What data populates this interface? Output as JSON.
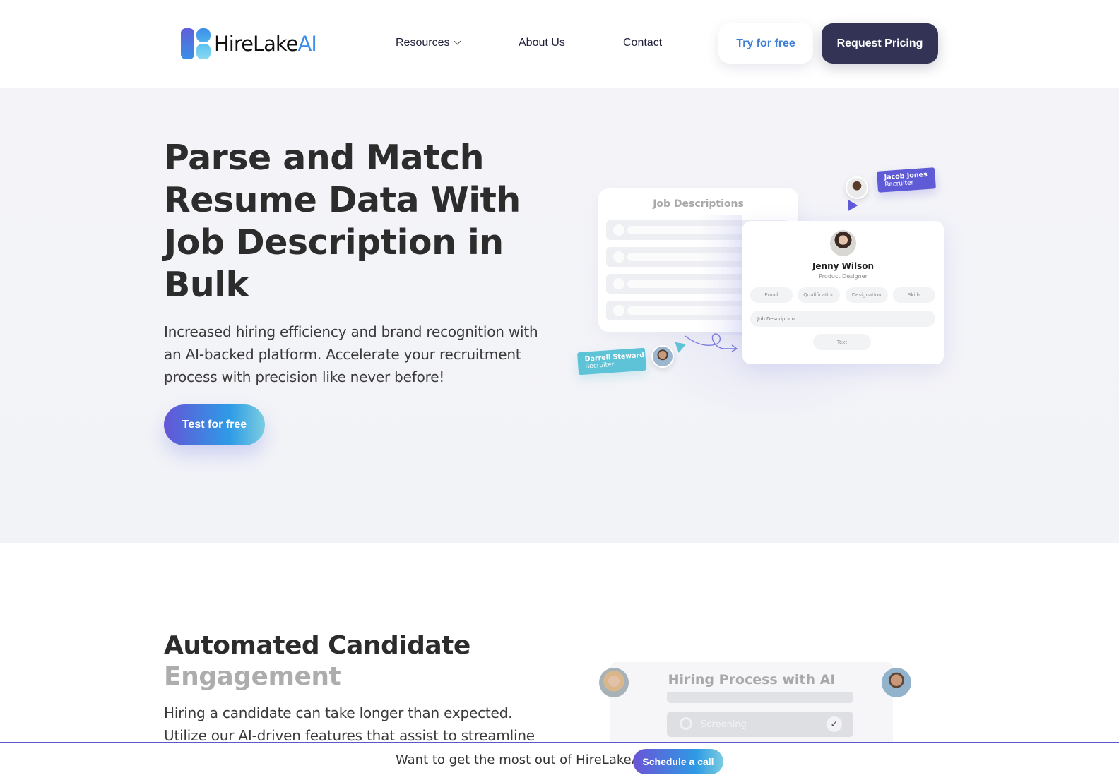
{
  "header": {
    "logo": {
      "text_main": "HireLake",
      "text_accent": "AI"
    },
    "nav": [
      {
        "label": "Resources",
        "has_dropdown": true
      },
      {
        "label": "About Us"
      },
      {
        "label": "Contact"
      }
    ],
    "try_button": "Try for free",
    "pricing_button": "Request Pricing"
  },
  "hero": {
    "title": "Parse and Match Resume Data With Job Description in Bulk",
    "subtitle": "Increased hiring efficiency and brand recognition with an AI-backed platform. Accelerate your recruitment process with precision like never before!",
    "cta": "Test for free",
    "illustration": {
      "jd_card_title": "Job Descriptions",
      "profile": {
        "name": "Jenny Wilson",
        "role": "Product Designer",
        "tags": [
          "Email",
          "Qualification",
          "Designation",
          "Skills"
        ],
        "field": "Job Description",
        "button": "Text"
      },
      "recruiter_top": {
        "name": "Jacob Jones",
        "role": "Recruiter"
      },
      "recruiter_bottom": {
        "name": "Darrell Steward",
        "role": "Recruiter"
      }
    }
  },
  "section2": {
    "title_dark": "Automated Candidate",
    "title_light": "Engagement",
    "body": "Hiring a candidate can take longer than expected. Utilize our AI-driven features that assist to streamline",
    "illustration": {
      "title": "Hiring Process with AI",
      "step": "Screening"
    }
  },
  "sticky_bar": {
    "text": "Want to get the most out of HireLakeAI?",
    "button": "Schedule a call"
  },
  "colors": {
    "primary_dark": "#333356",
    "accent_blue": "#3f7fd8",
    "purple": "#5f5ad6",
    "teal": "#5ec3d6"
  }
}
